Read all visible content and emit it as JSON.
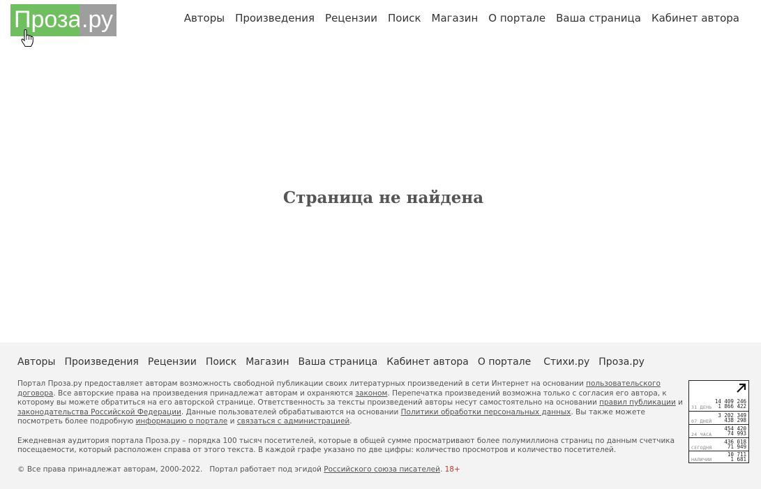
{
  "header": {
    "logo_part_a": "Проза",
    "logo_part_b": ".ру",
    "nav": [
      "Авторы",
      "Произведения",
      "Рецензии",
      "Поиск",
      "Магазин",
      "О портале",
      "Ваша страница",
      "Кабинет автора"
    ]
  },
  "main": {
    "message": "Страница не найдена"
  },
  "footer": {
    "nav": [
      "Авторы",
      "Произведения",
      "Рецензии",
      "Поиск",
      "Магазин",
      "Ваша страница",
      "Кабинет автора",
      "О портале"
    ],
    "nav_extra": [
      "Стихи.ру",
      "Проза.ру"
    ],
    "para1": {
      "t1": "Портал Проза.ру предоставляет авторам возможность свободной публикации своих литературных произведений в сети Интернет на основании ",
      "l1": "пользовательского договора",
      "t2": ". Все авторские права на произведения принадлежат авторам и охраняются ",
      "l2": "законом",
      "t3": ". Перепечатка произведений возможна только с согласия его автора, к которому вы можете обратиться на его авторской странице. Ответственность за тексты произведений авторы несут самостоятельно на основании ",
      "l3": "правил публикации",
      "t4": " и ",
      "l4": "законодательства Российской Федерации",
      "t5": ". Данные пользователей обрабатываются на основании ",
      "l5": "Политики обработки персональных данных",
      "t6": ". Вы также можете посмотреть более подробную ",
      "l6": "информацию о портале",
      "t7": " и ",
      "l7": "связаться с администрацией",
      "t8": "."
    },
    "para2": "Ежедневная аудитория портала Проза.ру – порядка 100 тысяч посетителей, которые в общей сумме просматривают более полумиллиона страниц по данным счетчика посещаемости, который расположен справа от этого текста. В каждой графе указано по две цифры: количество просмотров и количество посетителей.",
    "copyright": "© Все права принадлежат авторам, 2000-2022.   Портал работает под эгидой ",
    "union_link": "Российского союза писателей",
    "copyright_end": ".",
    "age": "18+"
  },
  "counter": {
    "rows": [
      {
        "label": "31 ДЕНЬ",
        "views": "14 409 246",
        "visitors": "1 866 422"
      },
      {
        "label": "07 ДНЕЙ",
        "views": "3 202 349",
        "visitors": "438 298"
      },
      {
        "label": "24 ЧАСА",
        "views": "454 420",
        "visitors": "74 993"
      },
      {
        "label": "СЕГОДНЯ",
        "views": "436 018",
        "visitors": "71 949"
      },
      {
        "label": "НАЛИЧИИ",
        "views": "10 711",
        "visitors": "1 681"
      }
    ]
  }
}
